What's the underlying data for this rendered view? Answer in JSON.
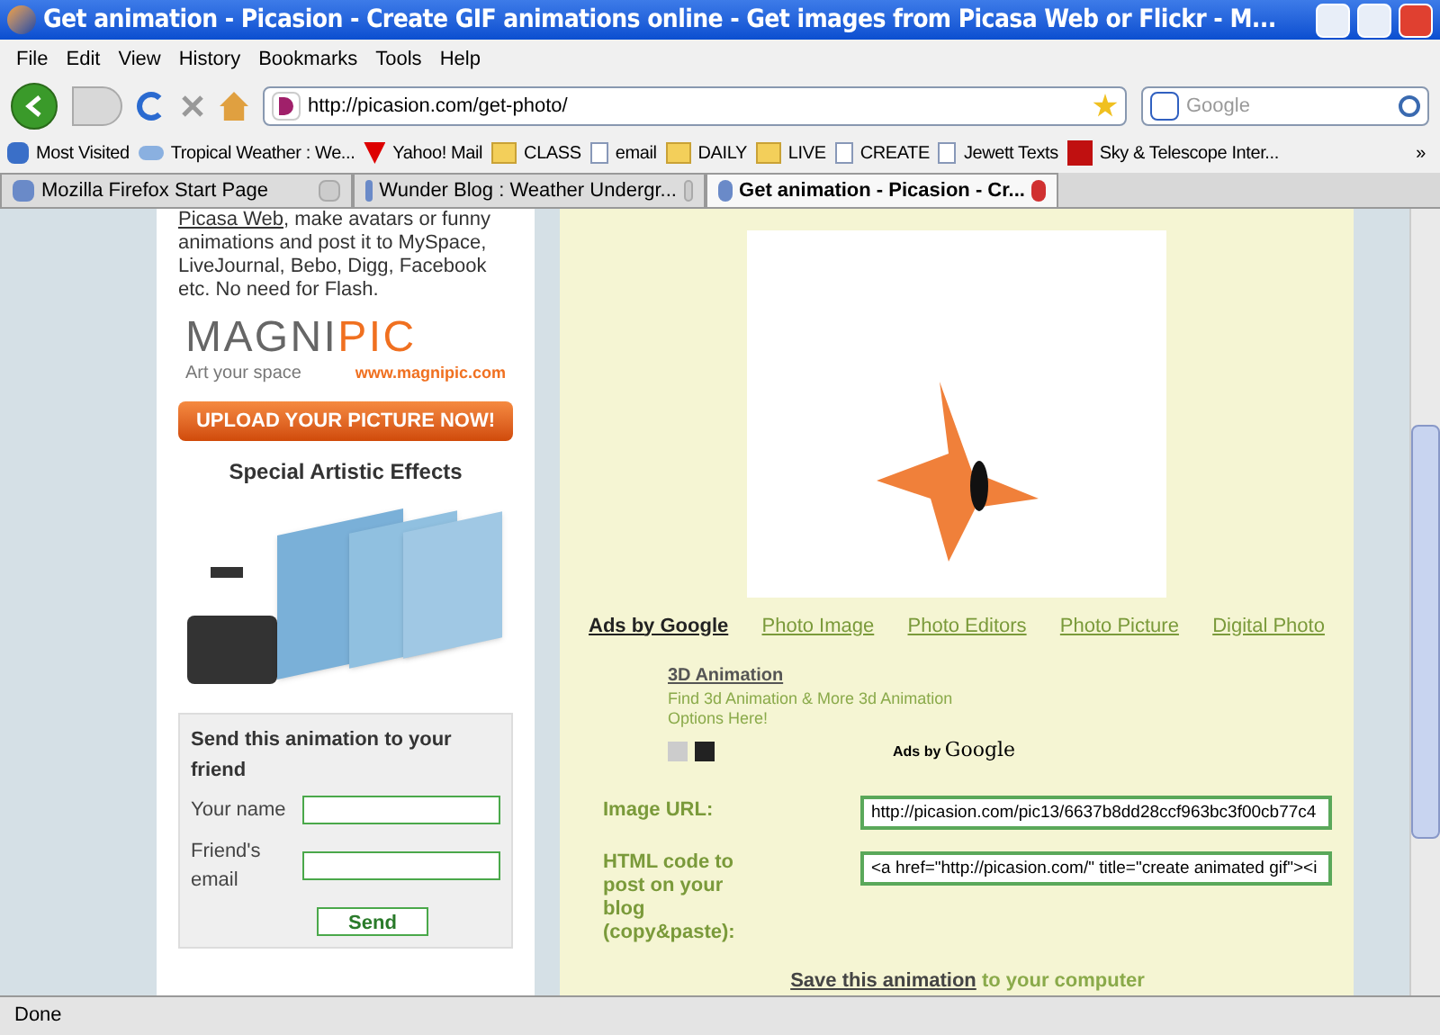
{
  "window": {
    "title": "Get animation - Picasion - Create GIF animations online - Get images from Picasa Web or Flickr - M..."
  },
  "menu": [
    "File",
    "Edit",
    "View",
    "History",
    "Bookmarks",
    "Tools",
    "Help"
  ],
  "address": {
    "value": "http://picasion.com/get-photo/"
  },
  "search": {
    "placeholder": "Google"
  },
  "bookmarks": [
    {
      "kind": "smart",
      "label": "Most Visited"
    },
    {
      "kind": "feed",
      "label": "Tropical Weather : We..."
    },
    {
      "kind": "yahoo",
      "label": "Yahoo! Mail"
    },
    {
      "kind": "folder",
      "label": "CLASS"
    },
    {
      "kind": "page",
      "label": "email"
    },
    {
      "kind": "folder",
      "label": "DAILY"
    },
    {
      "kind": "folder",
      "label": "LIVE"
    },
    {
      "kind": "page",
      "label": "CREATE"
    },
    {
      "kind": "page",
      "label": "Jewett Texts"
    },
    {
      "kind": "sky",
      "label": "Sky & Telescope Inter..."
    }
  ],
  "bookmarks_more": "»",
  "tabs": [
    {
      "label": "Mozilla Firefox Start Page",
      "selected": false
    },
    {
      "label": "Wunder Blog : Weather Undergr...",
      "selected": false
    },
    {
      "label": "Get animation - Picasion - Cr...",
      "selected": true
    }
  ],
  "left": {
    "intro_link": "Picasa Web",
    "intro_rest": ", make avatars or funny animations and post it to MySpace, LiveJournal, Bebo, Digg, Facebook etc. No need for Flash.",
    "logo_pre": "MAGNI",
    "logo_post": "PIC",
    "logo_tagline": "Art your space",
    "logo_url": "www.magnipic.com",
    "upload_button": "UPLOAD YOUR PICTURE NOW!",
    "effects_title": "Special Artistic Effects",
    "form": {
      "title": "Send this animation to your friend",
      "fields": [
        {
          "label": "Your name"
        },
        {
          "label": "Friend's email"
        }
      ],
      "button": "Send"
    }
  },
  "main": {
    "ads_label": "Ads by Google",
    "ad_links": [
      "Photo Image",
      "Photo Editors",
      "Photo Picture",
      "Digital Photo"
    ],
    "ad": {
      "title": "3D Animation",
      "text": "Find 3d Animation & More 3d Animation Options Here!",
      "badge_pre": "Ads by",
      "badge_brand": "Google"
    },
    "image_url": {
      "label": "Image URL:",
      "value": "http://picasion.com/pic13/6637b8dd28ccf963bc3f00cb77c4"
    },
    "html_code": {
      "label": "HTML code to post on your blog (copy&paste):",
      "value": "<a href=\"http://picasion.com/\" title=\"create animated gif\"><i"
    },
    "save_link": "Save this animation",
    "save_rest": " to your computer"
  },
  "status_bar": {
    "text": "Done"
  }
}
